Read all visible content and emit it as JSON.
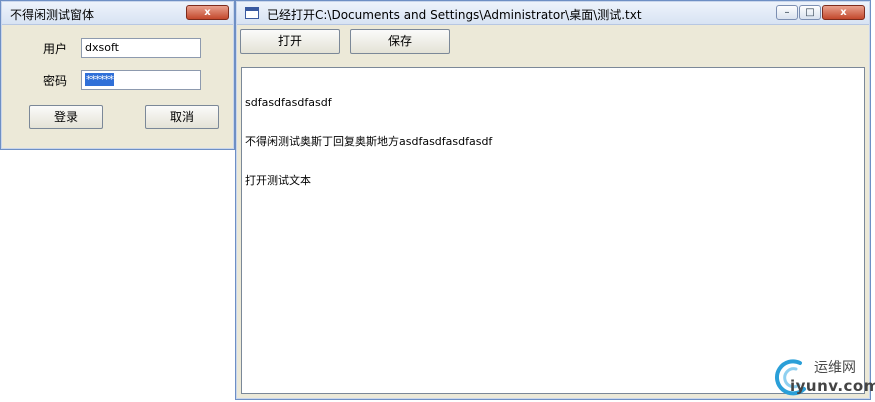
{
  "login_window": {
    "title": "不得闲测试窗体",
    "user_label": "用户",
    "user_value": "dxsoft",
    "password_label": "密码",
    "password_value": "******",
    "login_button": "登录",
    "cancel_button": "取消",
    "close_glyph": "x"
  },
  "editor_window": {
    "title": "已经打开C:\\Documents and Settings\\Administrator\\桌面\\测试.txt",
    "open_button": "打开",
    "save_button": "保存",
    "content_lines": [
      "sdfasdfasdfasdf",
      "不得闲测试奥斯丁回复奥斯地方asdfasdfasdfasdf",
      "打开测试文本"
    ],
    "minimize_glyph": "–",
    "maximize_glyph": "□",
    "close_glyph": "x"
  },
  "watermark": {
    "text_cn": "运维网",
    "text_en": "iyunv.com"
  },
  "colors": {
    "selection": "#3070d8",
    "window_border": "#6e8fc4",
    "close_button": "#c3482c"
  }
}
